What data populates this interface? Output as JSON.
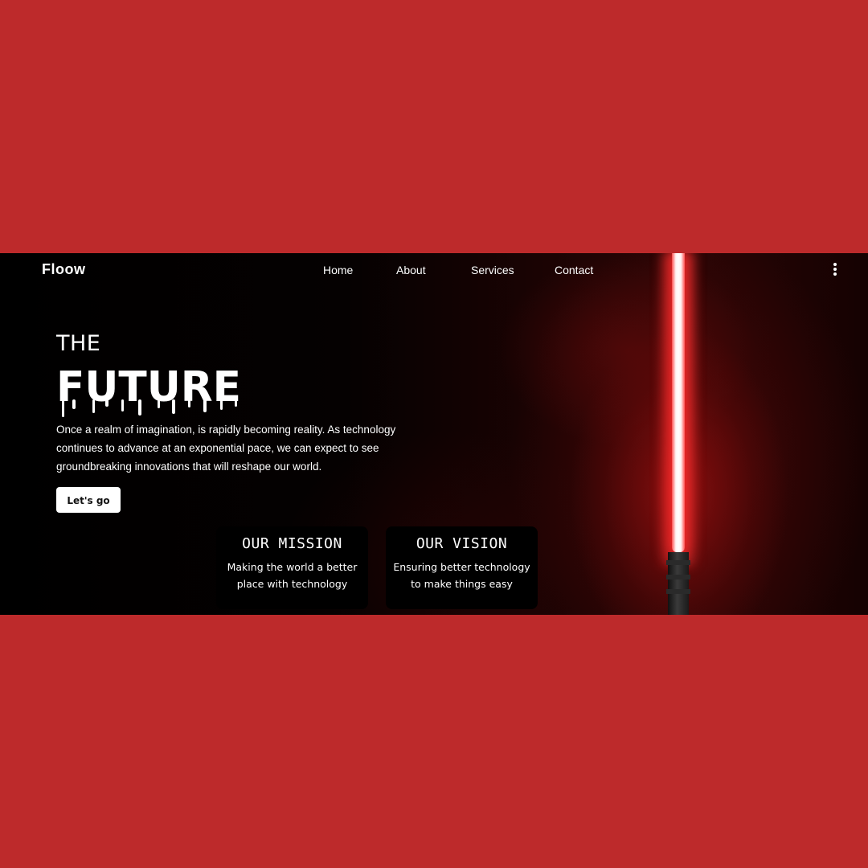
{
  "colors": {
    "page_background": "#bd2a2b",
    "hero_background": "#000000",
    "accent_saber": "#ff2a2a",
    "text": "#ffffff",
    "button_background": "#ffffff",
    "button_text": "#111111"
  },
  "nav": {
    "logo": "Floow",
    "links": [
      "Home",
      "About",
      "Services",
      "Contact"
    ],
    "menu_icon": "vertical-ellipsis-icon"
  },
  "hero": {
    "line1": "THE",
    "line2": "FUTURE",
    "description": "Once a realm of imagination, is rapidly becoming reality. As technology continues to advance at an exponential pace, we can expect to see groundbreaking innovations that will reshape our world.",
    "cta_label": "Let's go",
    "background_icon": "lightsaber-icon"
  },
  "cards": [
    {
      "title": "OUR MISSION",
      "text": "Making the world a better place with technology"
    },
    {
      "title": "OUR VISION",
      "text": "Ensuring better technology to make things easy"
    }
  ]
}
